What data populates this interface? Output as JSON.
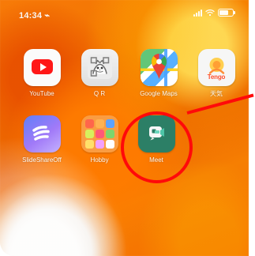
{
  "status_bar": {
    "time": "14:34 ⌁"
  },
  "apps": [
    {
      "label": "YouTube",
      "icon": "youtube-icon"
    },
    {
      "label": "Q R",
      "icon": "qr-cat-icon"
    },
    {
      "label": "Google Maps",
      "icon": "map-pin-icon"
    },
    {
      "label": "天気",
      "icon": "tengo-icon"
    },
    {
      "label": "SlideShareOff",
      "icon": "slides-icon"
    },
    {
      "label": "Hobby",
      "icon": "folder-icon"
    },
    {
      "label": "Meet",
      "icon": "meet-icon"
    }
  ],
  "badge": {
    "tengo_text": "Tengo"
  },
  "accent": {
    "highlight": "#ff0a0a",
    "wallpaper": "#f27400",
    "meet": "#2c7f66"
  }
}
